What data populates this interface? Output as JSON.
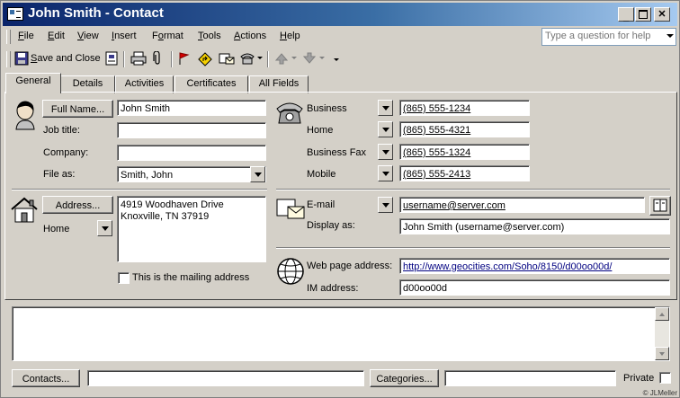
{
  "window": {
    "title": "John Smith - Contact"
  },
  "menu": [
    "File",
    "Edit",
    "View",
    "Insert",
    "Format",
    "Tools",
    "Actions",
    "Help"
  ],
  "ask": {
    "placeholder": "Type a question for help"
  },
  "toolbar": {
    "save_close": "Save and Close"
  },
  "tabs": [
    "General",
    "Details",
    "Activities",
    "Certificates",
    "All Fields"
  ],
  "name_section": {
    "full_name_button": "Full Name...",
    "full_name": "John Smith",
    "job_title_label": "Job title:",
    "job_title": "",
    "company_label": "Company:",
    "company": "",
    "file_as_label": "File as:",
    "file_as": "Smith, John"
  },
  "phones": [
    {
      "label": "Business",
      "value": "(865) 555-1234"
    },
    {
      "label": "Home",
      "value": "(865) 555-4321"
    },
    {
      "label": "Business Fax",
      "value": "(865) 555-1324"
    },
    {
      "label": "Mobile",
      "value": "(865) 555-2413"
    }
  ],
  "address_section": {
    "button": "Address...",
    "type": "Home",
    "line1": "4919 Woodhaven Drive",
    "line2": "Knoxville, TN  37919",
    "mailing_label": "This is the mailing address"
  },
  "email_section": {
    "label": "E-mail",
    "value": "username@server.com",
    "display_label": "Display as:",
    "display_value": "John Smith (username@server.com)"
  },
  "web_section": {
    "web_label": "Web page address:",
    "web_value": "http://www.geocities.com/Soho/8150/d00oo00d/",
    "im_label": "IM address:",
    "im_value": "d00oo00d"
  },
  "footer": {
    "contacts_button": "Contacts...",
    "categories_button": "Categories...",
    "private_label": "Private"
  },
  "credit": "© JLMeller",
  "colors": {
    "title_start": "#0a246a",
    "title_end": "#a6caf0",
    "face": "#d4d0c8",
    "link": "#000080"
  }
}
